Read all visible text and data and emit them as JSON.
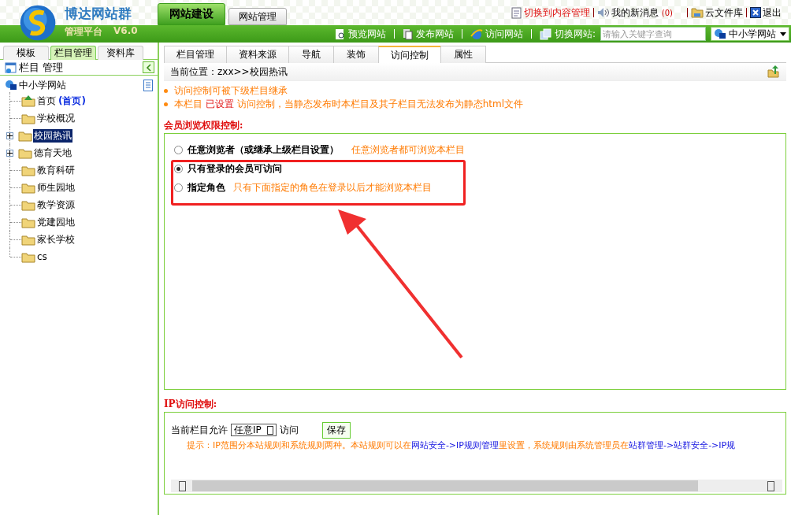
{
  "header": {
    "logo_title": "博达网站群",
    "logo_subtitle": "管理平台",
    "version": "V6.0",
    "main_tabs": [
      {
        "label": "网站建设",
        "selected": true
      },
      {
        "label": "网站管理",
        "selected": false
      }
    ],
    "top_links": [
      {
        "label": "切换到内容管理",
        "kind": "doc",
        "red": true
      },
      {
        "label": "我的新消息",
        "count": "(0)",
        "kind": "speaker",
        "red": false
      },
      {
        "label": "云文件库",
        "kind": "folder",
        "red": false
      },
      {
        "label": "退出",
        "kind": "close",
        "red": false
      }
    ],
    "toolbar": [
      {
        "label": "预览网站",
        "kind": "preview"
      },
      {
        "label": "发布网站",
        "kind": "publish"
      },
      {
        "label": "访问网站",
        "kind": "browser"
      },
      {
        "label": "切换网站:",
        "kind": "switch"
      }
    ],
    "search": {
      "placeholder": "请输入关键字查询"
    },
    "site_select": "中小学网站"
  },
  "sidebar": {
    "tabs": [
      {
        "label": "模板",
        "selected": false
      },
      {
        "label": "栏目管理",
        "selected": true
      },
      {
        "label": "资料库",
        "selected": false
      }
    ],
    "title": "栏目 管理",
    "tree": {
      "label": "中小学网站",
      "children": [
        {
          "label": "首页",
          "suffix": "(首页)",
          "home": true,
          "expandable": false,
          "selected": false
        },
        {
          "label": "学校概况",
          "home": false,
          "expandable": false,
          "selected": false
        },
        {
          "label": "校园热讯",
          "home": false,
          "expandable": true,
          "selected": true
        },
        {
          "label": "德育天地",
          "home": false,
          "expandable": true,
          "selected": false
        },
        {
          "label": "教育科研",
          "home": false,
          "expandable": false,
          "selected": false
        },
        {
          "label": "师生园地",
          "home": false,
          "expandable": false,
          "selected": false
        },
        {
          "label": "教学资源",
          "home": false,
          "expandable": false,
          "selected": false
        },
        {
          "label": "党建园地",
          "home": false,
          "expandable": false,
          "selected": false
        },
        {
          "label": "家长学校",
          "home": false,
          "expandable": false,
          "selected": false
        },
        {
          "label": "cs",
          "home": false,
          "expandable": false,
          "selected": false
        }
      ]
    }
  },
  "content": {
    "tabs": [
      {
        "label": "栏目管理",
        "selected": false
      },
      {
        "label": "资料来源",
        "selected": false
      },
      {
        "label": "导航",
        "selected": false
      },
      {
        "label": "装饰",
        "selected": false
      },
      {
        "label": "访问控制",
        "selected": true
      },
      {
        "label": "属性",
        "selected": false
      }
    ],
    "breadcrumb": "当前位置：zxx>>校园热讯",
    "notes": [
      [
        {
          "text": "访问控制可被下级栏目继承",
          "kind": "text"
        }
      ],
      [
        {
          "text": "本栏目 ",
          "kind": "text"
        },
        {
          "text": "已设置",
          "kind": "alert"
        },
        {
          "text": " 访问控制，当静态发布时本栏目及其子栏目无法发布为静态html文件",
          "kind": "text"
        }
      ]
    ],
    "member_section": {
      "title": "会员浏览权限控制:",
      "options": [
        {
          "label": "任意浏览者（或继承上级栏目设置）",
          "note": "任意浏览者都可浏览本栏目",
          "selected": false
        },
        {
          "label": "只有登录的会员可访问",
          "selected": true
        },
        {
          "label": "指定角色",
          "note": "只有下面指定的角色在登录以后才能浏览本栏目",
          "selected": false
        }
      ]
    },
    "ip_section": {
      "title": "IP访问控制:",
      "prefix": "当前栏目允许",
      "select": "任意IP",
      "suffix": "访问",
      "save": "保存",
      "tip": [
        {
          "text": "提示：IP范围分本站规则和系统规则两种。本站规则可以在",
          "kind": "text"
        },
        {
          "text": "网站安全->IP规则管理",
          "kind": "link"
        },
        {
          "text": "里设置，系统规则由系统管理员在",
          "kind": "text"
        },
        {
          "text": "站群管理->站群安全->IP规",
          "kind": "link"
        }
      ]
    }
  }
}
